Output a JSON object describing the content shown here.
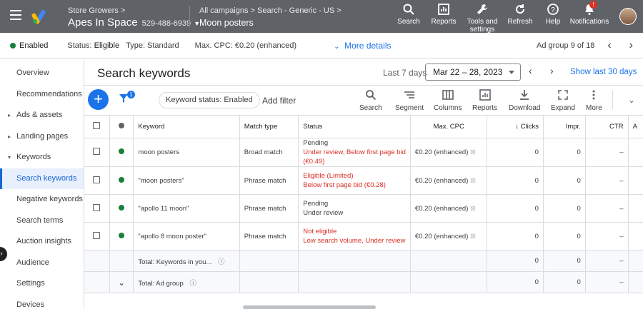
{
  "topbar": {
    "account_crumb": "Store Growers",
    "account_name": "Apes In Space",
    "account_id": "529-488-6939",
    "campaign_crumb": "All campaigns  >  Search - Generic - US",
    "adgroup_name": "Moon posters",
    "actions": [
      {
        "label": "Search",
        "icon": "search-icon"
      },
      {
        "label": "Reports",
        "icon": "reports-icon"
      },
      {
        "label": "Tools and settings",
        "icon": "wrench-icon"
      },
      {
        "label": "Refresh",
        "icon": "refresh-icon"
      },
      {
        "label": "Help",
        "icon": "help-icon"
      },
      {
        "label": "Notifications",
        "icon": "bell-icon"
      }
    ],
    "notif_count": "!"
  },
  "statusbar": {
    "enabled": "Enabled",
    "status_label": "Status:",
    "status_value": "Eligible",
    "type_label": "Type:",
    "type_value": "Standard",
    "cpc_label": "Max. CPC:",
    "cpc_value": "€0.20 (enhanced)",
    "more_details": "More details",
    "adgroup_pos": "Ad group 9 of 18"
  },
  "nav": {
    "items": [
      {
        "label": "Overview",
        "arrow": ""
      },
      {
        "label": "Recommendations",
        "arrow": ""
      },
      {
        "label": "Ads & assets",
        "arrow": "▸"
      },
      {
        "label": "Landing pages",
        "arrow": "▸"
      },
      {
        "label": "Keywords",
        "arrow": "▾"
      },
      {
        "label": "Search keywords",
        "arrow": ""
      },
      {
        "label": "Negative keywords",
        "arrow": ""
      },
      {
        "label": "Search terms",
        "arrow": ""
      },
      {
        "label": "Auction insights",
        "arrow": ""
      },
      {
        "label": "Audience",
        "arrow": ""
      },
      {
        "label": "Settings",
        "arrow": ""
      },
      {
        "label": "Devices",
        "arrow": ""
      }
    ],
    "active_index": 5
  },
  "main": {
    "title": "Search keywords",
    "date_label": "Last 7 days",
    "date_range": "Mar 22 – 28, 2023",
    "show_last": "Show last 30 days",
    "filter_count": "1",
    "chip": "Keyword status: Enabled",
    "add_filter": "Add filter",
    "tools": [
      "Search",
      "Segment",
      "Columns",
      "Reports",
      "Download",
      "Expand",
      "More"
    ]
  },
  "table": {
    "headers": [
      "Keyword",
      "Match type",
      "Status",
      "Max. CPC",
      "Clicks",
      "Impr.",
      "CTR"
    ],
    "rows": [
      {
        "keyword": "moon posters",
        "match": "Broad match",
        "status1": "Pending",
        "status2": "Under review, Below first page bid",
        "status3": "(€0.49)",
        "cpc": "€0.20 (enhanced)",
        "clicks": "0",
        "impr": "0",
        "ctr": "–"
      },
      {
        "keyword": "\"moon posters\"",
        "match": "Phrase match",
        "status1": "Eligible (Limited)",
        "status2": "Below first page bid (€0.28)",
        "status3": "",
        "cpc": "€0.20 (enhanced)",
        "clicks": "0",
        "impr": "0",
        "ctr": "–"
      },
      {
        "keyword": "\"apollo 11 moon\"",
        "match": "Phrase match",
        "status1": "Pending",
        "status2": "Under review",
        "status3": "",
        "cpc": "€0.20 (enhanced)",
        "clicks": "0",
        "impr": "0",
        "ctr": "–"
      },
      {
        "keyword": "\"apollo 8 moon poster\"",
        "match": "Phrase match",
        "status1": "Not eligible",
        "status2": "Low search volume, Under review",
        "status3": "",
        "cpc": "€0.20 (enhanced)",
        "clicks": "0",
        "impr": "0",
        "ctr": "–"
      }
    ],
    "totals": [
      {
        "label": "Total: Keywords in you...",
        "clicks": "0",
        "impr": "0",
        "ctr": "–"
      },
      {
        "label": "Total: Ad group",
        "clicks": "0",
        "impr": "0",
        "ctr": "–"
      }
    ]
  },
  "colors": {
    "accent": "#1a73e8",
    "topbar": "#5f6368",
    "enabled": "#188038",
    "error": "#d93025"
  }
}
